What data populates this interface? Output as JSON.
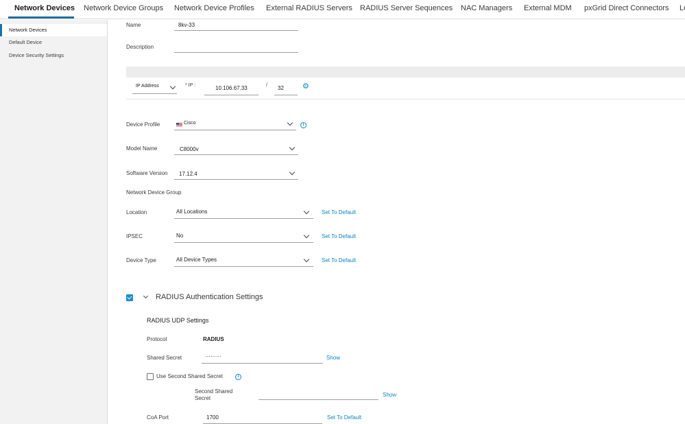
{
  "topnav": {
    "tabs": [
      {
        "label": "Network Devices",
        "active": true
      },
      {
        "label": "Network Device Groups"
      },
      {
        "label": "Network Device Profiles"
      },
      {
        "label": "External RADIUS Servers"
      },
      {
        "label": "RADIUS Server Sequences"
      },
      {
        "label": "NAC Managers"
      },
      {
        "label": "External MDM"
      },
      {
        "label": "pxGrid Direct Connectors"
      },
      {
        "label": "Lo"
      }
    ],
    "accent_color": "#1d6fa5"
  },
  "sidebar": {
    "items": [
      {
        "label": "Network Devices",
        "active": true
      },
      {
        "label": "Default Device"
      },
      {
        "label": "Device Security Settings"
      }
    ]
  },
  "form": {
    "name_label": "Name",
    "name_value": "8kv-33",
    "description_label": "Description",
    "description_value": "",
    "ip_type": "IP Address",
    "ip_label": "* IP :",
    "ip_value": "10.106.67.33",
    "ip_slash": "/",
    "ip_mask": "32",
    "device_profile_label": "Device Profile",
    "device_profile_value": "Cisco",
    "model_name_label": "Model Name",
    "model_name_value": "C8000v",
    "software_version_label": "Software Version",
    "software_version_value": "17.12.4",
    "ndg_label": "Network Device Group",
    "location_label": "Location",
    "location_value": "All Locations",
    "ipsec_label": "IPSEC",
    "ipsec_value": "No",
    "device_type_label": "Device Type",
    "device_type_value": "All Device Types",
    "set_default": "Set To Default"
  },
  "radius": {
    "section_title": "RADIUS Authentication Settings",
    "enabled": true,
    "udp_title": "RADIUS UDP Settings",
    "protocol_label": "Protocol",
    "protocol_value": "RADIUS",
    "shared_secret_label": "Shared Secret",
    "shared_secret_value": "·········",
    "show": "Show",
    "second_secret_checkbox_label": "Use Second Shared Secret",
    "second_secret_label_line1": "Second Shared",
    "second_secret_label_line2": "Secret",
    "coa_port_label": "CoA Port",
    "coa_port_value": "1700",
    "set_default": "Set To Default"
  },
  "colors": {
    "link": "#0d84c1",
    "checkbox": "#1d8bcd"
  }
}
